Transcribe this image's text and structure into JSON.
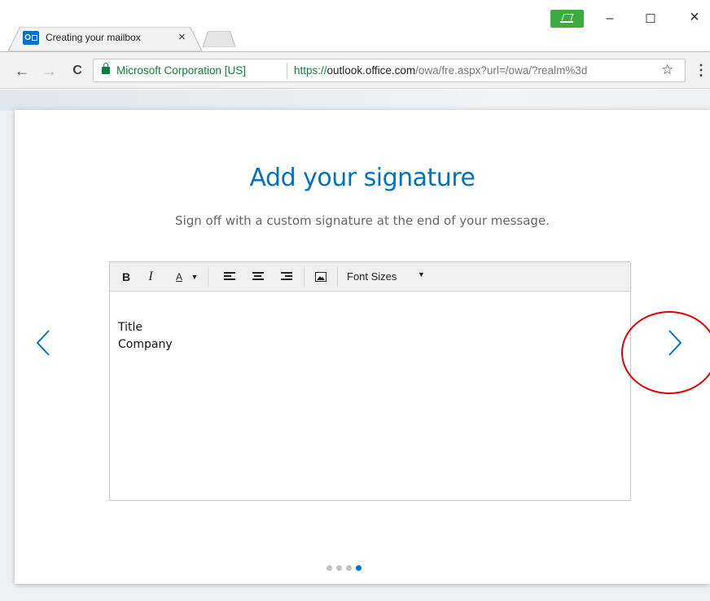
{
  "browser": {
    "tab_title": "Creating your mailbox",
    "tab_close": "×",
    "favicon_letter": "O",
    "window_minimize": "–",
    "window_maximize": "☐",
    "window_close": "×",
    "back_icon": "←",
    "forward_icon": "→",
    "reload_icon": "C",
    "ev_label": "Microsoft Corporation [US]",
    "url_scheme": "https://",
    "url_host": "outlook.office.com",
    "url_path": "/owa/fre.aspx?url=/owa/?realm%3d",
    "star_icon": "☆",
    "menu_icon": "⋮"
  },
  "page": {
    "title": "Add your signature",
    "subtitle": "Sign off with a custom signature at the end of your message."
  },
  "editor": {
    "toolbar": {
      "bold": "B",
      "italic": "I",
      "font_color": "A",
      "caret": "▼",
      "font_sizes": "Font Sizes",
      "font_sizes_caret": "▼"
    },
    "content_lines": [
      "Title",
      "Company"
    ]
  },
  "carousel": {
    "total_steps": 4,
    "active_step": 4
  },
  "colors": {
    "accent": "#0072c6",
    "ev_green": "#0b8043",
    "highlight_red": "#e00000"
  }
}
